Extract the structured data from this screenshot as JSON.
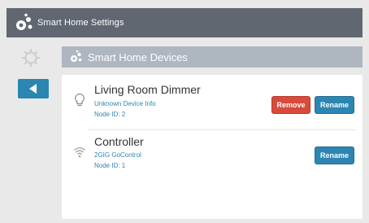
{
  "titlebar": {
    "title": "Smart Home Settings",
    "icon": "smart-home-logo-icon"
  },
  "sidebar": {
    "settings_icon": "gear-icon",
    "back_icon": "back-arrow-icon"
  },
  "section": {
    "title": "Smart Home Devices",
    "icon": "smart-home-devices-icon"
  },
  "devices": [
    {
      "name": "Living Room Dimmer",
      "info": "Unknown Device Info",
      "node": "Node ID: 2",
      "icon": "lightbulb-icon",
      "remove_label": "Remove",
      "rename_label": "Rename"
    },
    {
      "name": "Controller",
      "info": "2GIG GoControl",
      "node": "Node ID: 1",
      "icon": "wireless-signal-icon",
      "rename_label": "Rename"
    }
  ],
  "colors": {
    "titlebar": "#616770",
    "accent": "#2c86b2",
    "danger": "#d84a3a",
    "header": "#aeb6bf"
  }
}
